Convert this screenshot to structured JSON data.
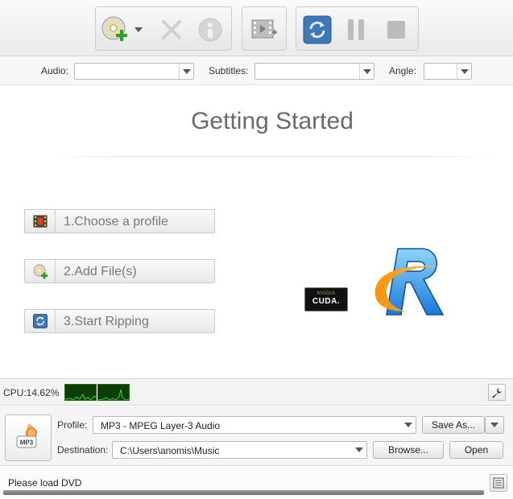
{
  "toolbar": {
    "groups": [
      {
        "name": "file",
        "buttons": [
          "load-dvd-icon",
          "dropdown-arrow-icon",
          "close-icon",
          "info-icon"
        ]
      },
      {
        "name": "edit",
        "buttons": [
          "add-video-icon"
        ]
      },
      {
        "name": "control",
        "buttons": [
          "convert-icon",
          "pause-icon",
          "stop-icon"
        ]
      }
    ]
  },
  "selectors": {
    "audio_label": "Audio:",
    "audio_value": "",
    "subtitles_label": "Subtitles:",
    "subtitles_value": "",
    "angle_label": "Angle:",
    "angle_value": ""
  },
  "main": {
    "title": "Getting Started",
    "steps": [
      {
        "label": "1.Choose a profile",
        "icon": "film-icon"
      },
      {
        "label": "2.Add File(s)",
        "icon": "add-disc-icon"
      },
      {
        "label": "3.Start Ripping",
        "icon": "convert-icon"
      }
    ],
    "badge": {
      "brand": "NVIDIA",
      "text": "CUDA."
    }
  },
  "cpu": {
    "label": "CPU:14.62%"
  },
  "profile": {
    "format_icon_text": "MP3",
    "profile_label": "Profile:",
    "profile_value": "MP3 - MPEG Layer-3 Audio",
    "save_as_label": "Save As...",
    "destination_label": "Destination:",
    "destination_value": "C:\\Users\\anomis\\Music",
    "browse_label": "Browse...",
    "open_label": "Open"
  },
  "status": {
    "text": "Please load DVD"
  },
  "colors": {
    "accent_blue": "#3d78b8",
    "toolbar_bg": "#efefef",
    "cpu_graph": "#0c3d05"
  }
}
